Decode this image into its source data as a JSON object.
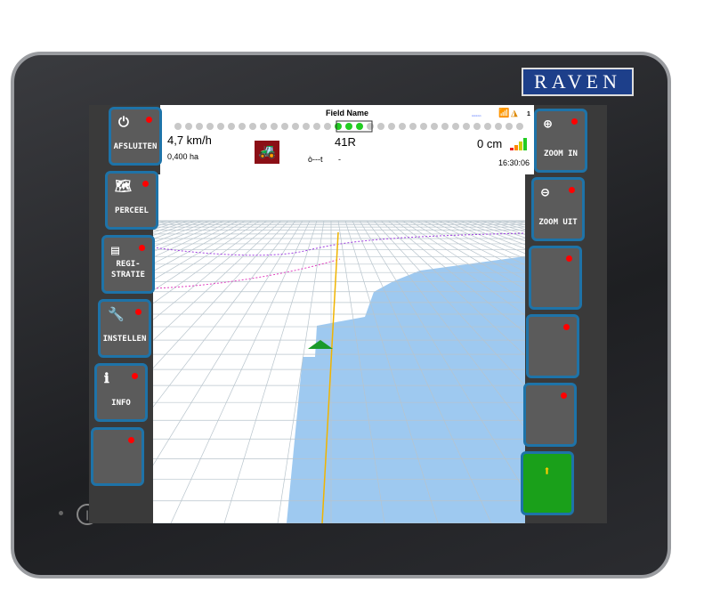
{
  "brand": "RAVEN",
  "topbar": {
    "field_name": "Field Name",
    "speed": "4,7 km/h",
    "area": "0,400 ha",
    "line": "41R",
    "offset": "0 cm",
    "time": "16:30:06",
    "implement": "-",
    "gps_sats": "1"
  },
  "left_buttons": [
    {
      "label": "AFSLUITEN",
      "icon": "exit-icon"
    },
    {
      "label": "PERCEEL",
      "icon": "field-icon"
    },
    {
      "label": "REGI-\nSTRATIE",
      "icon": "registration-icon"
    },
    {
      "label": "INSTELLEN",
      "icon": "tools-icon"
    },
    {
      "label": "INFO",
      "icon": "info-icon"
    },
    {
      "label": "",
      "icon": ""
    }
  ],
  "right_buttons": [
    {
      "label": "ZOOM IN",
      "icon": "zoom-in-icon"
    },
    {
      "label": "ZOOM UIT",
      "icon": "zoom-out-icon"
    },
    {
      "label": ""
    },
    {
      "label": ""
    },
    {
      "label": ""
    },
    {
      "label": "",
      "icon": "arrow-up-icon"
    }
  ],
  "colors": {
    "accent": "#1e73a8",
    "coverage": "#9ec9f0",
    "guidance": "#f0b400",
    "status_led": "#ff0000",
    "lightbar_on": "#22cc22"
  }
}
